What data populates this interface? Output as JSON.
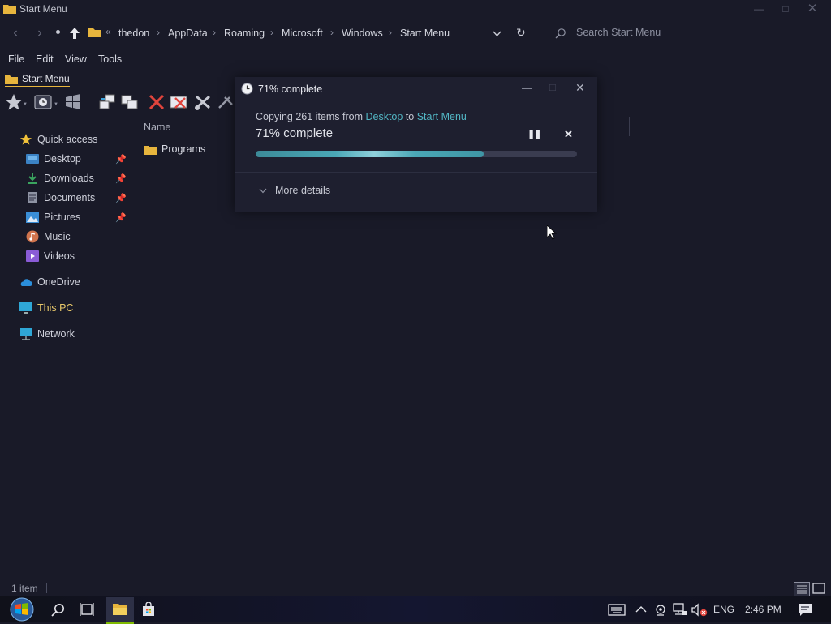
{
  "window": {
    "title": "Start Menu"
  },
  "address": {
    "prefix": "«",
    "crumbs": [
      "thedon",
      "AppData",
      "Roaming",
      "Microsoft",
      "Windows",
      "Start Menu"
    ],
    "search_placeholder": "Search Start Menu"
  },
  "menu": [
    "File",
    "Edit",
    "View",
    "Tools"
  ],
  "favorites": {
    "item": "Start Menu"
  },
  "nav": {
    "quick_access": "Quick access",
    "items": [
      {
        "label": "Desktop",
        "pinned": true,
        "color": "#3b82c4"
      },
      {
        "label": "Downloads",
        "pinned": true,
        "color": "#3aa45f"
      },
      {
        "label": "Documents",
        "pinned": true,
        "color": "#8e93a3"
      },
      {
        "label": "Pictures",
        "pinned": true,
        "color": "#3a8ed6"
      },
      {
        "label": "Music",
        "pinned": false,
        "color": "#d0744d"
      },
      {
        "label": "Videos",
        "pinned": false,
        "color": "#8a5bd6"
      }
    ],
    "onedrive": "OneDrive",
    "this_pc": "This PC",
    "network": "Network"
  },
  "content": {
    "column_name": "Name",
    "items": [
      "Programs"
    ]
  },
  "dialog": {
    "title": "71% complete",
    "copying_prefix": "Copying 261 items from ",
    "source": "Desktop",
    "to_word": " to ",
    "destination": "Start Menu",
    "percent_text": "71% complete",
    "progress": 0.71,
    "more_details": "More details"
  },
  "status": {
    "count": "1 item"
  },
  "tray": {
    "language": "ENG",
    "time": "2:46 PM"
  },
  "colors": {
    "accent": "#52b6c4",
    "background": "#191a28",
    "dialog": "#1e1f2f"
  }
}
